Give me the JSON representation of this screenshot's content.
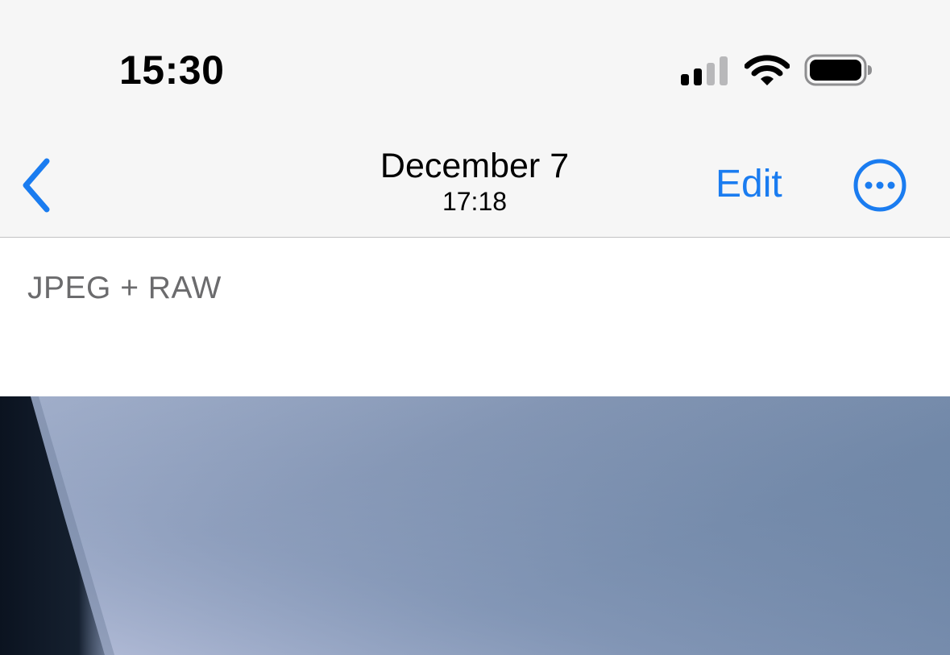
{
  "status_bar": {
    "time": "15:30"
  },
  "nav": {
    "title": "December 7",
    "subtitle": "17:18",
    "edit_label": "Edit",
    "accent_color": "#1a7cf0"
  },
  "photo_info": {
    "format_label": "JPEG + RAW"
  },
  "icons": {
    "back": "chevron-left-icon",
    "more": "ellipsis-circle-icon",
    "signal": "cellular-signal-icon",
    "wifi": "wifi-icon",
    "battery": "battery-icon"
  }
}
